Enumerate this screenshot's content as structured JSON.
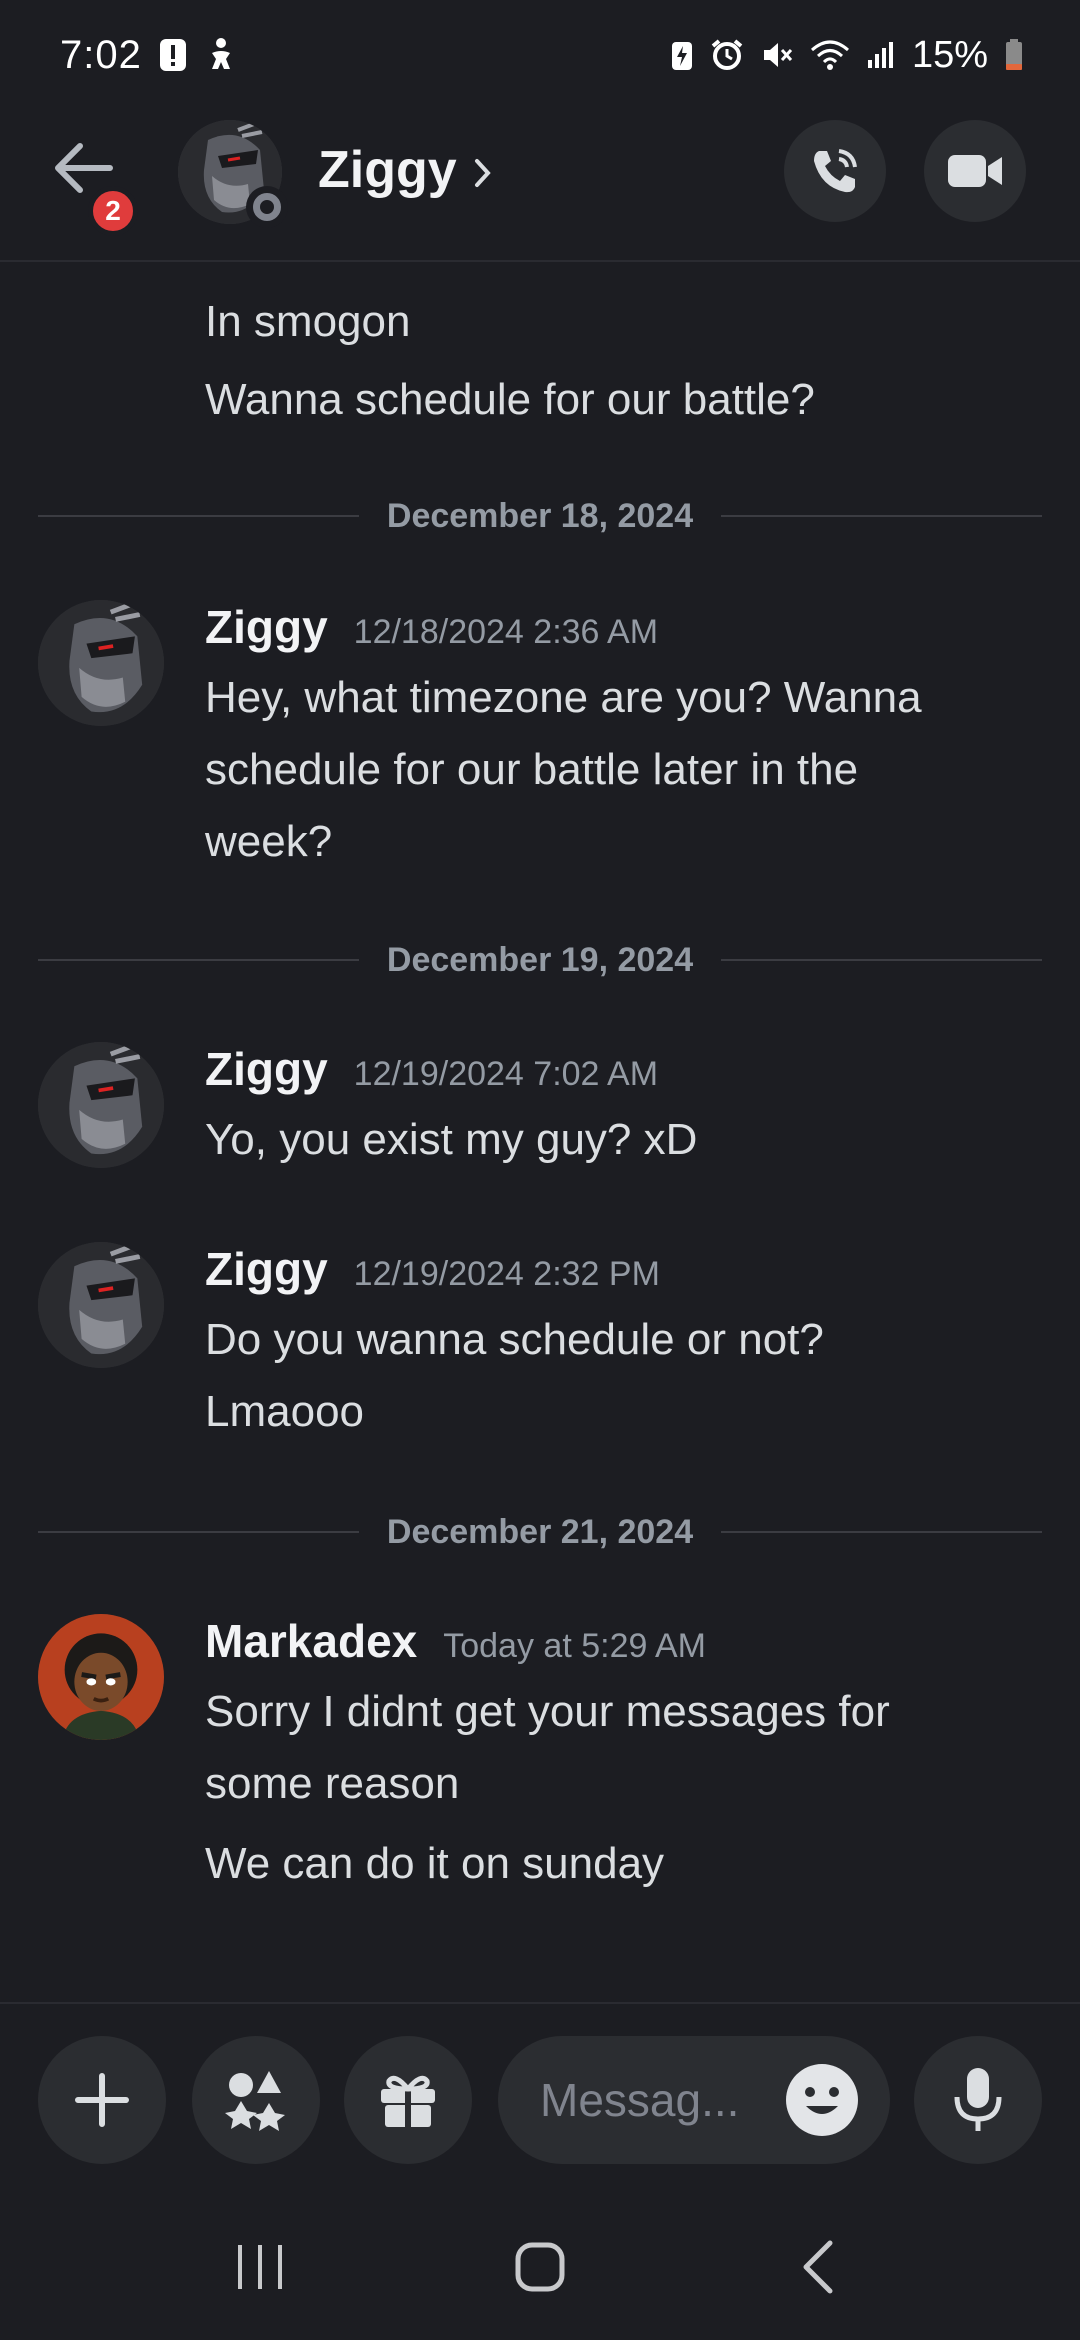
{
  "status_bar": {
    "time": "7:02",
    "battery": "15%",
    "left_icons": [
      "alert-icon",
      "accessibility-icon"
    ],
    "right_icons": [
      "battery-saver-icon",
      "alarm-icon",
      "mute-icon",
      "wifi-icon",
      "signal-icon",
      "battery-icon"
    ]
  },
  "header": {
    "back_badge": "2",
    "name": "Ziggy",
    "chevron": "›"
  },
  "chat": {
    "continuation": [
      "In smogon",
      "Wanna schedule for our battle?"
    ],
    "dividers": [
      "December 18, 2024",
      "December 19, 2024",
      "December 21, 2024"
    ],
    "messages": [
      {
        "author": "Ziggy",
        "timestamp": "12/18/2024 2:36 AM",
        "lines": [
          "Hey, what timezone are you? Wanna",
          "schedule for our battle later in the",
          "week?"
        ]
      },
      {
        "author": "Ziggy",
        "timestamp": "12/19/2024 7:02 AM",
        "lines": [
          "Yo, you exist my guy? xD"
        ]
      },
      {
        "author": "Ziggy",
        "timestamp": "12/19/2024 2:32 PM",
        "lines": [
          "Do you wanna schedule or not?",
          "Lmaooo"
        ]
      },
      {
        "author": "Markadex",
        "timestamp": "Today at 5:29 AM",
        "lines": [
          "Sorry I didnt get your messages for",
          "some reason",
          "We can do it on sunday"
        ]
      }
    ]
  },
  "composer": {
    "placeholder": "Messag..."
  },
  "colors": {
    "background": "#1c1d22",
    "surface": "#2b2d31",
    "badge_red": "#e03c3c",
    "muted_text": "#949ba4"
  }
}
